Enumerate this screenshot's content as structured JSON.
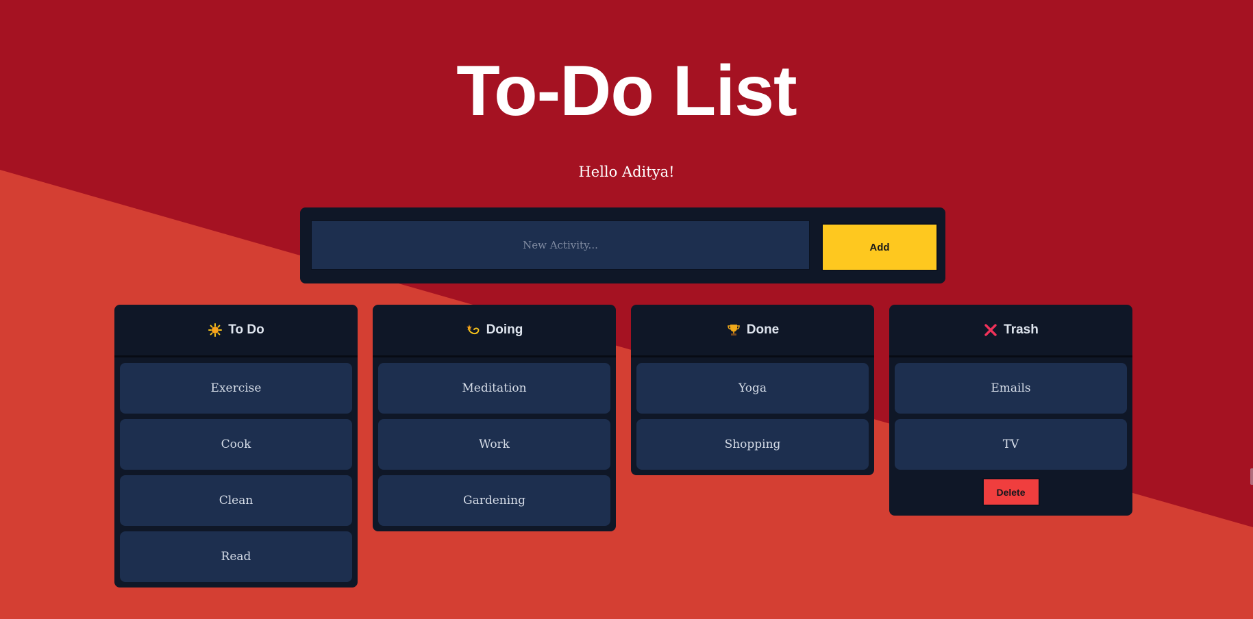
{
  "colors": {
    "background_dark": "#a51222",
    "background_light": "#d43f33",
    "panel": "#0f1727",
    "card": "#1d2f4f",
    "accent_add": "#fec81f",
    "accent_delete": "#f03e3e"
  },
  "header": {
    "title": "To-Do List",
    "greeting": "Hello Aditya!"
  },
  "add_form": {
    "input_placeholder": "New Activity...",
    "input_value": "",
    "add_label": "Add"
  },
  "columns": {
    "todo": {
      "icon": "sun-icon",
      "title": "To Do",
      "items": [
        "Exercise",
        "Cook",
        "Clean",
        "Read"
      ]
    },
    "doing": {
      "icon": "dizzy-icon",
      "title": "Doing",
      "items": [
        "Meditation",
        "Work",
        "Gardening"
      ]
    },
    "done": {
      "icon": "trophy-icon",
      "title": "Done",
      "items": [
        "Yoga",
        "Shopping"
      ]
    },
    "trash": {
      "icon": "cross-mark-icon",
      "title": "Trash",
      "items": [
        "Emails",
        "TV"
      ],
      "delete_label": "Delete"
    }
  }
}
